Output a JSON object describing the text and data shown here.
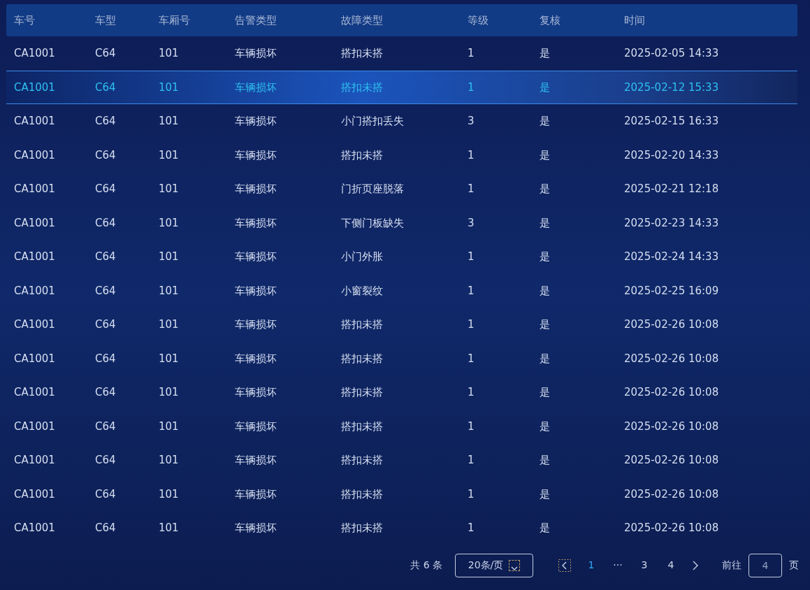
{
  "table": {
    "columns": [
      "车号",
      "车型",
      "车厢号",
      "告警类型",
      "故障类型",
      "等级",
      "复核",
      "时间"
    ],
    "rows": [
      {
        "cells": [
          "CA1001",
          "C64",
          "101",
          "车辆损坏",
          "搭扣未搭",
          "1",
          "是",
          "2025-02-05 14:33"
        ],
        "selected": false
      },
      {
        "cells": [
          "CA1001",
          "C64",
          "101",
          "车辆损坏",
          "搭扣未搭",
          "1",
          "是",
          "2025-02-12 15:33"
        ],
        "selected": true
      },
      {
        "cells": [
          "CA1001",
          "C64",
          "101",
          "车辆损坏",
          "小门搭扣丢失",
          "3",
          "是",
          "2025-02-15 16:33"
        ],
        "selected": false
      },
      {
        "cells": [
          "CA1001",
          "C64",
          "101",
          "车辆损坏",
          "搭扣未搭",
          "1",
          "是",
          "2025-02-20 14:33"
        ],
        "selected": false
      },
      {
        "cells": [
          "CA1001",
          "C64",
          "101",
          "车辆损坏",
          "门折页座脱落",
          "1",
          "是",
          "2025-02-21 12:18"
        ],
        "selected": false
      },
      {
        "cells": [
          "CA1001",
          "C64",
          "101",
          "车辆损坏",
          "下侧门板缺失",
          "3",
          "是",
          "2025-02-23 14:33"
        ],
        "selected": false
      },
      {
        "cells": [
          "CA1001",
          "C64",
          "101",
          "车辆损坏",
          "小门外胀",
          "1",
          "是",
          "2025-02-24 14:33"
        ],
        "selected": false
      },
      {
        "cells": [
          "CA1001",
          "C64",
          "101",
          "车辆损坏",
          "小窗裂纹",
          "1",
          "是",
          "2025-02-25 16:09"
        ],
        "selected": false
      },
      {
        "cells": [
          "CA1001",
          "C64",
          "101",
          "车辆损坏",
          "搭扣未搭",
          "1",
          "是",
          "2025-02-26 10:08"
        ],
        "selected": false
      },
      {
        "cells": [
          "CA1001",
          "C64",
          "101",
          "车辆损坏",
          "搭扣未搭",
          "1",
          "是",
          "2025-02-26 10:08"
        ],
        "selected": false
      },
      {
        "cells": [
          "CA1001",
          "C64",
          "101",
          "车辆损坏",
          "搭扣未搭",
          "1",
          "是",
          "2025-02-26 10:08"
        ],
        "selected": false
      },
      {
        "cells": [
          "CA1001",
          "C64",
          "101",
          "车辆损坏",
          "搭扣未搭",
          "1",
          "是",
          "2025-02-26 10:08"
        ],
        "selected": false
      },
      {
        "cells": [
          "CA1001",
          "C64",
          "101",
          "车辆损坏",
          "搭扣未搭",
          "1",
          "是",
          "2025-02-26 10:08"
        ],
        "selected": false
      },
      {
        "cells": [
          "CA1001",
          "C64",
          "101",
          "车辆损坏",
          "搭扣未搭",
          "1",
          "是",
          "2025-02-26 10:08"
        ],
        "selected": false
      },
      {
        "cells": [
          "CA1001",
          "C64",
          "101",
          "车辆损坏",
          "搭扣未搭",
          "1",
          "是",
          "2025-02-26 10:08"
        ],
        "selected": false
      }
    ]
  },
  "pagination": {
    "total": "共 6 条",
    "page_size": "20条/页",
    "pages": [
      {
        "label": "1",
        "selected": true
      },
      {
        "label": "···",
        "selected": false
      },
      {
        "label": "3",
        "selected": false
      },
      {
        "label": "4",
        "selected": false
      }
    ],
    "goto_label": "前往",
    "goto_value": "4",
    "goto_suffix": "页"
  }
}
